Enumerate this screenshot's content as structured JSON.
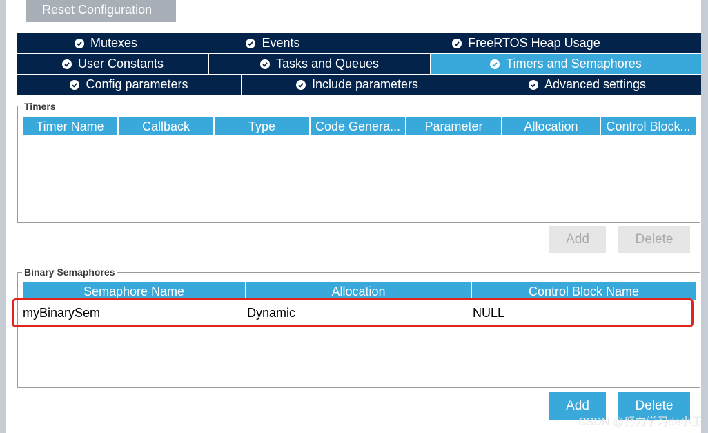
{
  "toolbar": {
    "reset_label": "Reset Configuration"
  },
  "tabs": {
    "row1": [
      "Mutexes",
      "Events",
      "FreeRTOS Heap Usage"
    ],
    "row2": [
      "User Constants",
      "Tasks and Queues",
      "Timers and Semaphores"
    ],
    "row3": [
      "Config parameters",
      "Include parameters",
      "Advanced settings"
    ],
    "active": "Timers and Semaphores",
    "icon": "check-circle-icon"
  },
  "timers": {
    "legend": "Timers",
    "columns": [
      "Timer Name",
      "Callback",
      "Type",
      "Code Genera...",
      "Parameter",
      "Allocation",
      "Control Block..."
    ],
    "rows": [],
    "add_label": "Add",
    "delete_label": "Delete"
  },
  "binary_semaphores": {
    "legend": "Binary Semaphores",
    "columns": [
      "Semaphore Name",
      "Allocation",
      "Control Block Name"
    ],
    "rows": [
      [
        "myBinarySem",
        "Dynamic",
        "NULL"
      ]
    ],
    "add_label": "Add",
    "delete_label": "Delete"
  },
  "colors": {
    "accent": "#39a9dc",
    "tab_dark": "#03234b",
    "highlight": "#e2231a"
  },
  "watermark": "CSDN @努力学习de小王"
}
